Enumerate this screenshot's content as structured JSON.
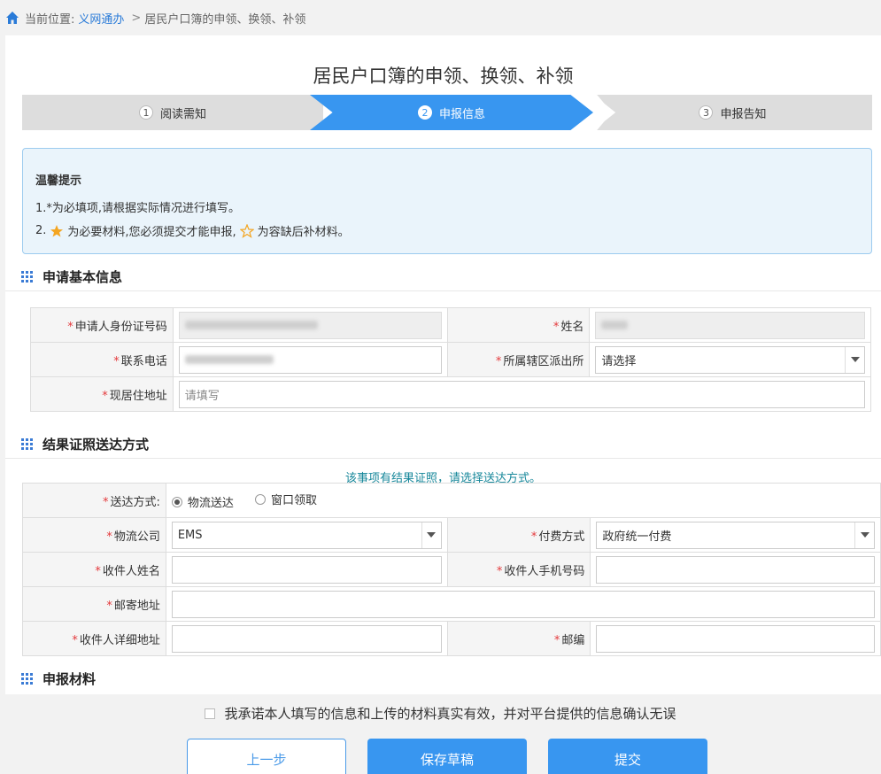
{
  "breadcrumb": {
    "prefix": "当前位置:",
    "link": "义网通办",
    "separator": ">",
    "current": "居民户口簿的申领、换领、补领"
  },
  "page_title": "居民户口簿的申领、换领、补领",
  "steps": [
    {
      "num": "1",
      "label": "阅读需知"
    },
    {
      "num": "2",
      "label": "申报信息"
    },
    {
      "num": "3",
      "label": "申报告知"
    }
  ],
  "notice": {
    "title": "温馨提示",
    "line1": "1.*为必填项,请根据实际情况进行填写。",
    "line2_prefix": "2.",
    "line2_mid": "为必要材料,您必须提交才能申报,",
    "line2_suffix": "为容缺后补材料。"
  },
  "basic": {
    "heading": "申请基本信息",
    "id_label": "申请人身份证号码",
    "name_label": "姓名",
    "phone_label": "联系电话",
    "police_label": "所属辖区派出所",
    "police_value": "请选择",
    "address_label": "现居住地址",
    "address_placeholder": "请填写"
  },
  "delivery": {
    "heading": "结果证照送达方式",
    "hint": "该事项有结果证照，请选择送达方式。",
    "method_label": "送达方式:",
    "method_opt1": "物流送达",
    "method_opt2": "窗口领取",
    "company_label": "物流公司",
    "company_value": "EMS",
    "pay_label": "付费方式",
    "pay_value": "政府统一付费",
    "recv_name_label": "收件人姓名",
    "recv_phone_label": "收件人手机号码",
    "mail_addr_label": "邮寄地址",
    "recv_addr_label": "收件人详细地址",
    "postcode_label": "邮编"
  },
  "materials": {
    "heading": "申报材料"
  },
  "commit_text": "我承诺本人填写的信息和上传的材料真实有效，并对平台提供的信息确认无误",
  "buttons": {
    "prev": "上一步",
    "save": "保存草稿",
    "submit": "提交"
  },
  "colors": {
    "accent": "#3896f0",
    "required": "#e4393c",
    "hint": "#16879a"
  }
}
